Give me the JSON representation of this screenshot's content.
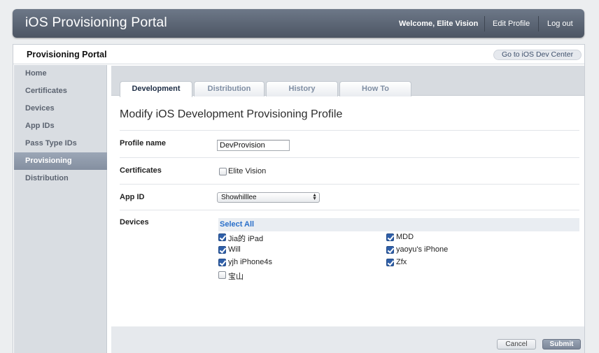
{
  "header": {
    "app_title": "iOS Provisioning Portal",
    "welcome": "Welcome, Elite Vision",
    "edit_profile": "Edit Profile",
    "logout": "Log out"
  },
  "portal": {
    "title": "Provisioning Portal",
    "dev_center_link": "Go to iOS Dev Center"
  },
  "sidebar": {
    "items": [
      {
        "label": "Home"
      },
      {
        "label": "Certificates"
      },
      {
        "label": "Devices"
      },
      {
        "label": "App IDs"
      },
      {
        "label": "Pass Type IDs"
      },
      {
        "label": "Provisioning"
      },
      {
        "label": "Distribution"
      }
    ],
    "active": "Provisioning"
  },
  "tabs": [
    {
      "label": "Development"
    },
    {
      "label": "Distribution"
    },
    {
      "label": "History"
    },
    {
      "label": "How To"
    }
  ],
  "active_tab": "Development",
  "form": {
    "heading": "Modify iOS Development Provisioning Profile",
    "profile_name_label": "Profile name",
    "profile_name_value": "DevProvision",
    "certificates_label": "Certificates",
    "certificate": {
      "name": "Elite Vision",
      "checked": false
    },
    "app_id_label": "App ID",
    "app_id_value": "Showhilllee",
    "devices_label": "Devices",
    "select_all": "Select All",
    "devices": [
      {
        "name": "Jia的 iPad",
        "checked": true
      },
      {
        "name": "MDD",
        "checked": true
      },
      {
        "name": "Will",
        "checked": true
      },
      {
        "name": "yaoyu's iPhone",
        "checked": true
      },
      {
        "name": "yjh iPhone4s",
        "checked": true
      },
      {
        "name": "Zfx",
        "checked": true
      },
      {
        "name": "宝山",
        "checked": false
      }
    ]
  },
  "footer": {
    "cancel": "Cancel",
    "submit": "Submit"
  },
  "colors": {
    "header_bar": "#5d6776",
    "active_sidebar": "#8f9aab",
    "link_blue": "#2a6fc9",
    "checkbox_blue": "#2f5fa8"
  }
}
